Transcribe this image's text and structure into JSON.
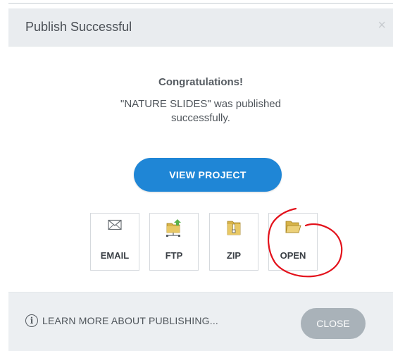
{
  "dialog": {
    "title": "Publish Successful",
    "close_glyph": "×"
  },
  "body": {
    "heading": "Congratulations!",
    "message": "\"NATURE SLIDES\" was published successfully.",
    "view_button_label": "VIEW PROJECT"
  },
  "publish_options": [
    {
      "label": "EMAIL",
      "icon": "envelope-icon"
    },
    {
      "label": "FTP",
      "icon": "ftp-folder-icon"
    },
    {
      "label": "ZIP",
      "icon": "zip-folder-icon"
    },
    {
      "label": "OPEN",
      "icon": "open-folder-icon"
    }
  ],
  "annotation": {
    "color": "#e3111b",
    "shape": "hand-drawn circle around OPEN"
  },
  "footer": {
    "info_glyph": "i",
    "learn_more_label": "LEARN MORE ABOUT PUBLISHING...",
    "close_label": "CLOSE"
  },
  "colors": {
    "accent": "#1f86d6",
    "close_button": "#a9b2b9",
    "titlebar": "#e9ecef",
    "footer": "#eceff2"
  }
}
